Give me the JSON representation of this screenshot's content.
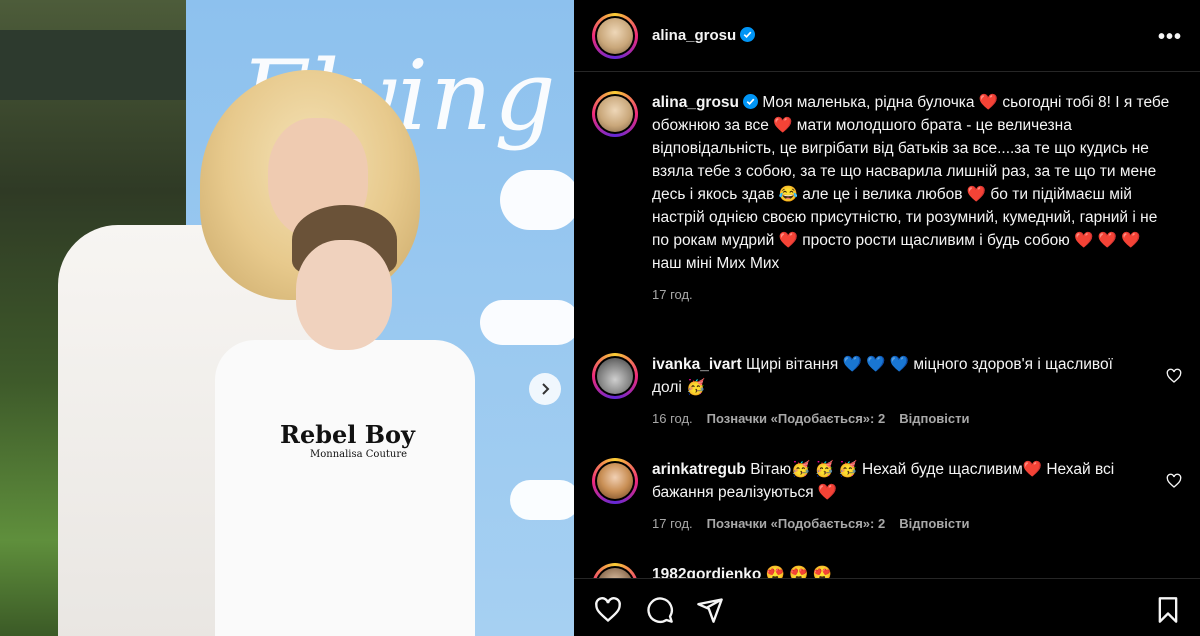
{
  "post": {
    "username": "alina_grosu",
    "more_icon": "more-horizontal-icon",
    "photo_shirt_line1": "Rebel Boy",
    "photo_shirt_line2": "Monnalisa Couture",
    "photo_backdrop_text": "Flying",
    "caption": {
      "username": "alina_grosu",
      "text": "Моя маленька, рідна булочка ❤️ сьогодні тобі 8! І я тебе обожнюю за все ❤️ мати молодшого брата - це величезна відповідальність, це вигрібати від батьків за все....за те що кудись не взяла тебе з собою, за те що насварила лишній раз, за те що ти мене десь і якось здав 😂 але це і велика любов ❤️ бо ти підіймаєш мій настрій однією своєю присутністю, ти розумний, кумедний, гарний і не по рокам мудрий ❤️ просто рости щасливим і будь собою ❤️ ❤️ ❤️ наш міні Мих Мих",
      "time": "17 год."
    },
    "comments": [
      {
        "username": "ivanka_ivart",
        "text": "Щирі вітання 💙 💙 💙 міцного здоров'я і щасливої долі 🥳",
        "time": "16 год.",
        "likes": "Позначки «Подобається»: 2",
        "reply": "Відповісти"
      },
      {
        "username": "arinkatregub",
        "text": "Вітаю🥳 🥳 🥳 Нехай буде щасливим❤️ Нехай всі бажання реалізуються ❤️",
        "time": "17 год.",
        "likes": "Позначки «Подобається»: 2",
        "reply": "Відповісти"
      },
      {
        "username": "1982gordienko",
        "text": "😍 😍 😍"
      }
    ],
    "actions": {
      "like_icon": "heart-icon",
      "comment_icon": "comment-icon",
      "share_icon": "send-icon",
      "save_icon": "bookmark-icon"
    }
  }
}
